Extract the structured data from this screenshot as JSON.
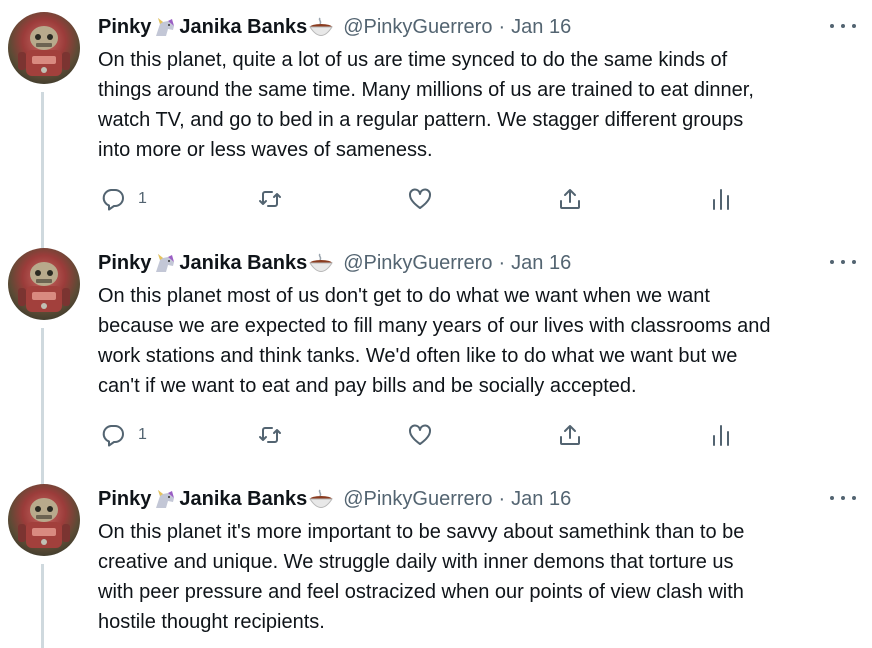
{
  "colors": {
    "text": "#0f1419",
    "secondary": "#536471",
    "thread_line": "#cfd9de",
    "background": "#ffffff"
  },
  "icons": {
    "avatar": "robot-avatar",
    "name_emoji_1": "unicorn-emoji",
    "name_emoji_2": "bowl-emoji",
    "reply": "reply-icon",
    "retweet": "retweet-icon",
    "like": "heart-icon",
    "share": "share-icon",
    "views": "views-icon",
    "more": "more-icon"
  },
  "tweets": [
    {
      "name_part1": "Pinky",
      "name_part2": "Janika Banks",
      "handle": "@PinkyGuerrero",
      "separator": "·",
      "date": "Jan 16",
      "lines": [
        "On this planet, quite a lot of us are time synced to do the same kinds of",
        "things around the same time. Many millions of us are trained to eat dinner,",
        "watch TV, and go to bed in a regular pattern. We stagger different groups",
        "into more or less waves of sameness."
      ],
      "reply_count": "1"
    },
    {
      "name_part1": "Pinky",
      "name_part2": "Janika Banks",
      "handle": "@PinkyGuerrero",
      "separator": "·",
      "date": "Jan 16",
      "lines": [
        "On this planet most of us don't get to do what we want when we want",
        "because we are expected to fill many years of our lives with classrooms and",
        "work stations and think tanks. We'd often like to do what we want but we",
        "can't if we want to eat and pay bills and be socially accepted."
      ],
      "reply_count": "1"
    },
    {
      "name_part1": "Pinky",
      "name_part2": "Janika Banks",
      "handle": "@PinkyGuerrero",
      "separator": "·",
      "date": "Jan 16",
      "lines": [
        "On this planet it's more important to be savvy about samethink than to be",
        "creative and unique. We struggle daily with inner demons that torture us",
        "with peer pressure and feel ostracized when our points of view clash with",
        "hostile thought  recipients."
      ]
    }
  ]
}
